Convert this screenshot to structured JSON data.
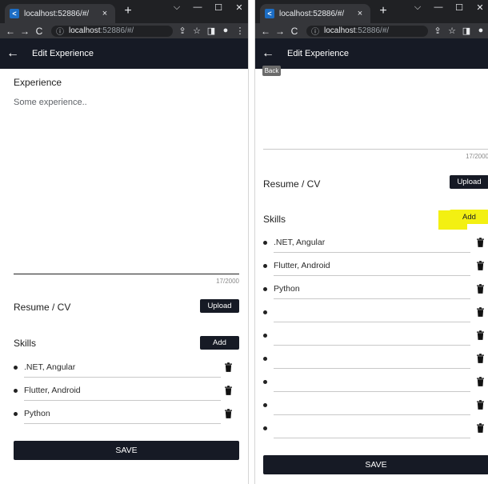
{
  "browser": {
    "tab_title": "localhost:52886/#/",
    "tab_close": "×",
    "new_tab": "+",
    "window_controls": [
      "⌵",
      "—",
      "☐",
      "✕"
    ],
    "address_host": "localhost",
    "address_rest": ":52886/#/",
    "favicon_glyph": "<"
  },
  "app": {
    "title": "Edit Experience",
    "back_tooltip": "Back"
  },
  "experience": {
    "label": "Experience",
    "value": "Some experience..",
    "counter": "17/2000"
  },
  "resume": {
    "label": "Resume / CV",
    "upload_label": "Upload"
  },
  "skills": {
    "label": "Skills",
    "add_label": "Add",
    "left_items": [
      ".NET, Angular",
      "Flutter, Android",
      "Python"
    ],
    "right_items": [
      ".NET, Angular",
      "Flutter, Android",
      "Python",
      "",
      "",
      "",
      "",
      "",
      ""
    ]
  },
  "save_label": "SAVE",
  "colors": {
    "appbar": "#161a25",
    "highlight": "#f3f012",
    "browser_chrome": "#202124"
  },
  "icons": {
    "trash": "trash-icon",
    "back": "arrow-left-icon"
  }
}
